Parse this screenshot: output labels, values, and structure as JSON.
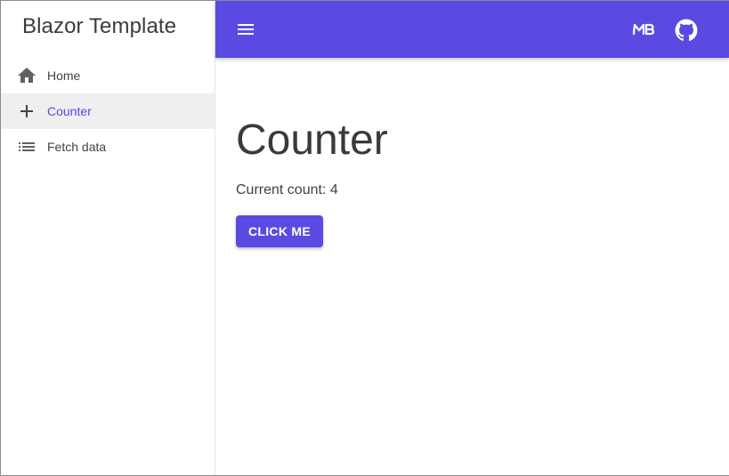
{
  "drawer": {
    "brand": "Blazor Template",
    "items": [
      {
        "label": "Home",
        "icon": "home-icon",
        "active": false
      },
      {
        "label": "Counter",
        "icon": "plus-icon",
        "active": true
      },
      {
        "label": "Fetch data",
        "icon": "list-icon",
        "active": false
      }
    ]
  },
  "appbar": {
    "icons": [
      "menu-icon",
      "mudblazor-icon",
      "github-icon"
    ]
  },
  "main": {
    "title": "Counter",
    "count_label": "Current count: 4",
    "button_label": "CLICK ME"
  },
  "colors": {
    "primary": "#594ae2",
    "active_bg": "#efefef",
    "text": "#424242"
  }
}
